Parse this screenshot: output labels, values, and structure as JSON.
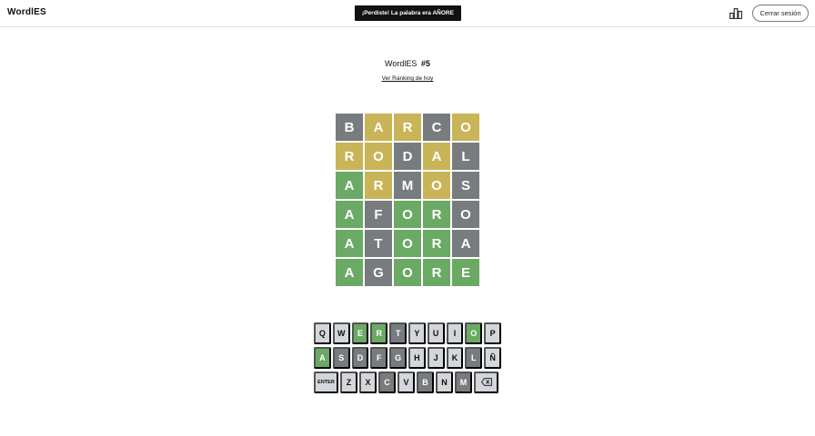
{
  "header": {
    "logo": "WordlES",
    "toast": "¡Perdiste! La palabra era AÑORE",
    "logout_label": "Cerrar sesión",
    "ranking_icon": "bar-chart-icon"
  },
  "game": {
    "title": "WordlES",
    "number": "#5",
    "ranking_link": "Ver Ranking de hoy"
  },
  "colors": {
    "absent": "#787c7e",
    "present": "#c9b458",
    "correct": "#6aaa64",
    "key_default": "#d3d6da"
  },
  "board": {
    "rows": [
      [
        {
          "letter": "B",
          "state": "absent"
        },
        {
          "letter": "A",
          "state": "present"
        },
        {
          "letter": "R",
          "state": "present"
        },
        {
          "letter": "C",
          "state": "absent"
        },
        {
          "letter": "O",
          "state": "present"
        }
      ],
      [
        {
          "letter": "R",
          "state": "present"
        },
        {
          "letter": "O",
          "state": "present"
        },
        {
          "letter": "D",
          "state": "absent"
        },
        {
          "letter": "A",
          "state": "present"
        },
        {
          "letter": "L",
          "state": "absent"
        }
      ],
      [
        {
          "letter": "A",
          "state": "correct"
        },
        {
          "letter": "R",
          "state": "present"
        },
        {
          "letter": "M",
          "state": "absent"
        },
        {
          "letter": "O",
          "state": "present"
        },
        {
          "letter": "S",
          "state": "absent"
        }
      ],
      [
        {
          "letter": "A",
          "state": "correct"
        },
        {
          "letter": "F",
          "state": "absent"
        },
        {
          "letter": "O",
          "state": "correct"
        },
        {
          "letter": "R",
          "state": "correct"
        },
        {
          "letter": "O",
          "state": "absent"
        }
      ],
      [
        {
          "letter": "A",
          "state": "correct"
        },
        {
          "letter": "T",
          "state": "absent"
        },
        {
          "letter": "O",
          "state": "correct"
        },
        {
          "letter": "R",
          "state": "correct"
        },
        {
          "letter": "A",
          "state": "absent"
        }
      ],
      [
        {
          "letter": "A",
          "state": "correct"
        },
        {
          "letter": "G",
          "state": "absent"
        },
        {
          "letter": "O",
          "state": "correct"
        },
        {
          "letter": "R",
          "state": "correct"
        },
        {
          "letter": "E",
          "state": "correct"
        }
      ]
    ]
  },
  "keyboard": {
    "rows": [
      [
        {
          "label": "Q",
          "state": "unused"
        },
        {
          "label": "W",
          "state": "unused"
        },
        {
          "label": "E",
          "state": "correct"
        },
        {
          "label": "R",
          "state": "correct"
        },
        {
          "label": "T",
          "state": "absent"
        },
        {
          "label": "Y",
          "state": "unused"
        },
        {
          "label": "U",
          "state": "unused"
        },
        {
          "label": "I",
          "state": "unused"
        },
        {
          "label": "O",
          "state": "correct"
        },
        {
          "label": "P",
          "state": "unused"
        }
      ],
      [
        {
          "label": "A",
          "state": "correct"
        },
        {
          "label": "S",
          "state": "absent"
        },
        {
          "label": "D",
          "state": "absent"
        },
        {
          "label": "F",
          "state": "absent"
        },
        {
          "label": "G",
          "state": "absent"
        },
        {
          "label": "H",
          "state": "unused"
        },
        {
          "label": "J",
          "state": "unused"
        },
        {
          "label": "K",
          "state": "unused"
        },
        {
          "label": "L",
          "state": "absent"
        },
        {
          "label": "Ñ",
          "state": "unused"
        }
      ],
      [
        {
          "label": "ENTER",
          "state": "unused",
          "type": "enter"
        },
        {
          "label": "Z",
          "state": "unused"
        },
        {
          "label": "X",
          "state": "unused"
        },
        {
          "label": "C",
          "state": "absent"
        },
        {
          "label": "V",
          "state": "unused"
        },
        {
          "label": "B",
          "state": "absent"
        },
        {
          "label": "N",
          "state": "unused"
        },
        {
          "label": "M",
          "state": "absent"
        },
        {
          "label": "",
          "state": "unused",
          "type": "backspace",
          "icon": "backspace-icon"
        }
      ]
    ]
  }
}
